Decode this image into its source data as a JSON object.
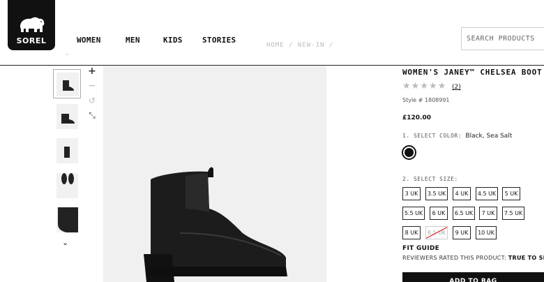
{
  "brand": {
    "logo_text": "SOREL"
  },
  "nav": {
    "items": [
      "WOMEN",
      "MEN",
      "KIDS",
      "STORIES"
    ]
  },
  "breadcrumb": "HOME / NEW-IN /",
  "search": {
    "placeholder": "SEARCH PRODUCTS"
  },
  "gallery": {
    "thumbnails": [
      "boot-side-view",
      "boot-three-quarter-view",
      "boot-front-view",
      "boot-top-view",
      "boot-detail-view"
    ],
    "tools": [
      "zoom-in",
      "zoom-out",
      "rotate",
      "expand"
    ]
  },
  "product": {
    "title": "WOMEN'S JANEY™ CHELSEA BOOT",
    "rating_stars": 0,
    "rating_max": 5,
    "review_count": "(2)",
    "style": "Style # 1808991",
    "price": "£120.00",
    "color_label": "1. SELECT COLOR:",
    "color_value": "Black, Sea Salt",
    "color_swatch": "#111111",
    "size_label": "2. SELECT SIZE:",
    "sizes": [
      {
        "label": "3 UK",
        "available": true
      },
      {
        "label": "3.5 UK",
        "available": true
      },
      {
        "label": "4 UK",
        "available": true
      },
      {
        "label": "4.5 UK",
        "available": true
      },
      {
        "label": "5 UK",
        "available": true
      },
      {
        "label": "5.5 UK",
        "available": true
      },
      {
        "label": "6 UK",
        "available": true
      },
      {
        "label": "6.5 UK",
        "available": true
      },
      {
        "label": "7 UK",
        "available": true
      },
      {
        "label": "7.5 UK",
        "available": true
      },
      {
        "label": "8 UK",
        "available": true
      },
      {
        "label": "8.5 UK",
        "available": false
      },
      {
        "label": "9 UK",
        "available": true
      },
      {
        "label": "10 UK",
        "available": true
      }
    ],
    "fit_guide": "FIT GUIDE",
    "rated_prefix": "REVIEWERS RATED THIS PRODUCT:",
    "rated_value": "TRUE TO SIZE",
    "add_to_bag": "ADD TO BAG"
  }
}
